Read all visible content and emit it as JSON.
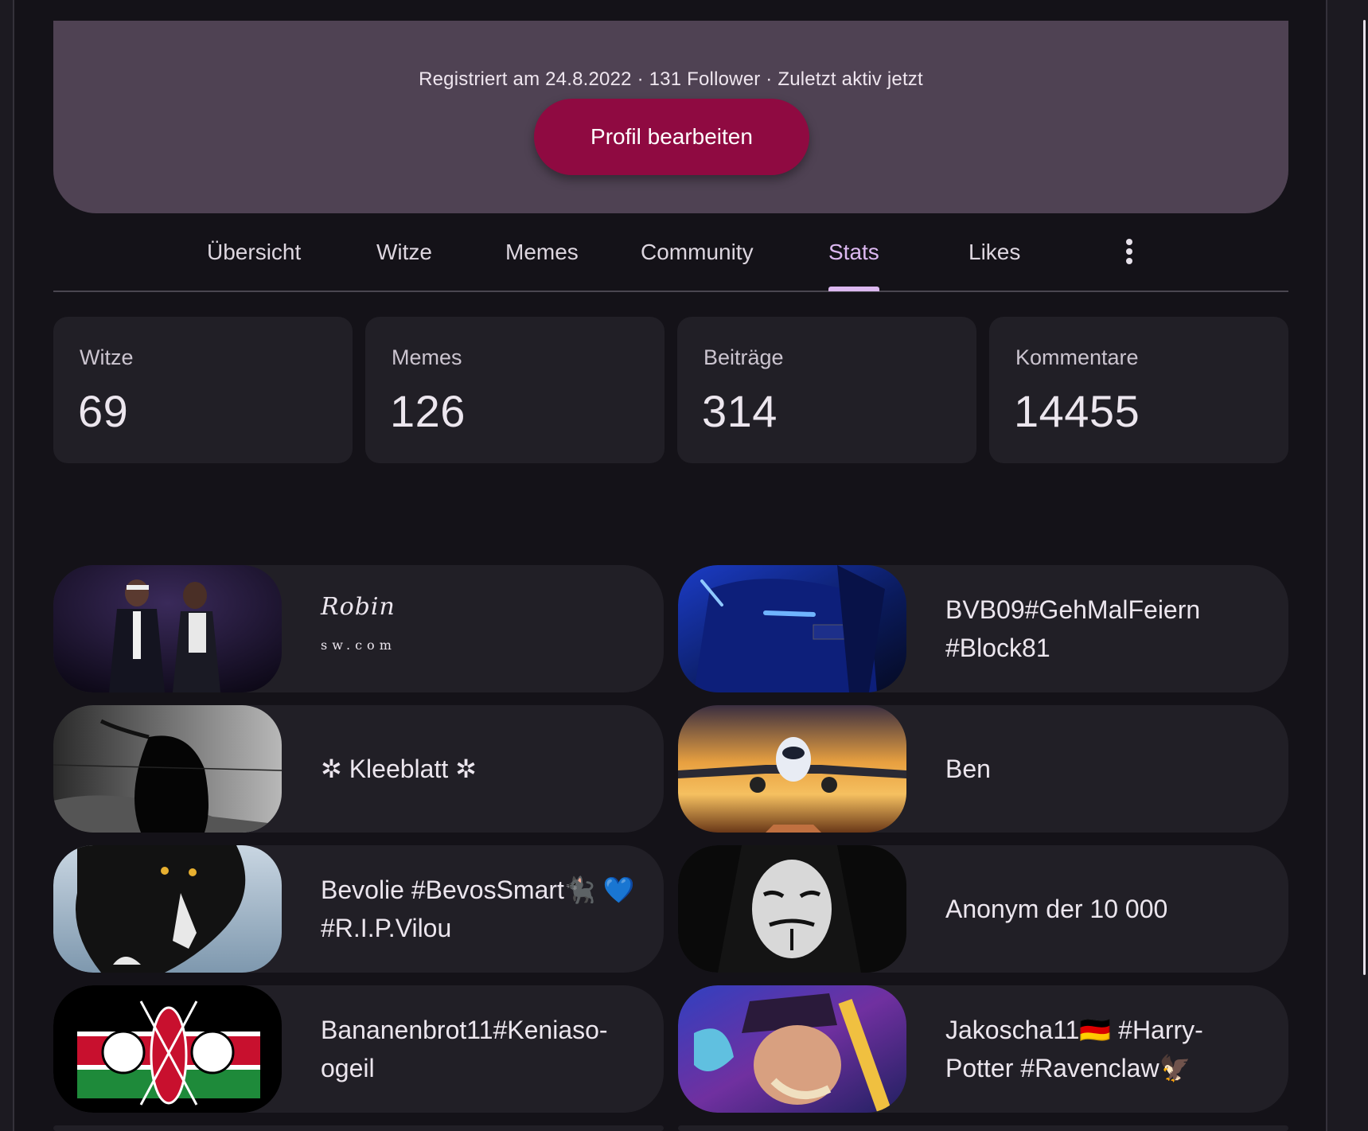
{
  "profile": {
    "meta": "Registriert am 24.8.2022 · 131 Follower · Zuletzt aktiv jetzt",
    "edit_button": "Profil bearbeiten"
  },
  "tabs": [
    {
      "label": "Übersicht",
      "active": false
    },
    {
      "label": "Witze",
      "active": false
    },
    {
      "label": "Memes",
      "active": false
    },
    {
      "label": "Community",
      "active": false
    },
    {
      "label": "Stats",
      "active": true
    },
    {
      "label": "Likes",
      "active": false
    }
  ],
  "tab_more_icon": "more-vertical-icon",
  "stats": [
    {
      "label": "Witze",
      "value": "69"
    },
    {
      "label": "Memes",
      "value": "126"
    },
    {
      "label": "Beiträge",
      "value": "314"
    },
    {
      "label": "Kommentare",
      "value": "14455"
    }
  ],
  "users": [
    {
      "name": "Robin",
      "name_suffix": "sw.com"
    },
    {
      "name": "BVB09#GehMalFeiern #Block81"
    },
    {
      "name": "✲ Kleeblatt ✲"
    },
    {
      "name": "Ben"
    },
    {
      "name": "Bevolie #BevosSmart🐈‍⬛ 💙 #R.I.P.Vilou"
    },
    {
      "name": "Anonym der 10 000"
    },
    {
      "name": "Bananenbrot11#Keniaso-ogeil"
    },
    {
      "name": "Jakoscha11🇩🇪 #Harry-Potter #Ravenclaw🦅"
    }
  ],
  "colors": {
    "background": "#141218",
    "profile_card": "#4f4253",
    "primary_button": "#8f0a41",
    "tile": "#211f26",
    "active_tab": "#dcb8f0"
  }
}
